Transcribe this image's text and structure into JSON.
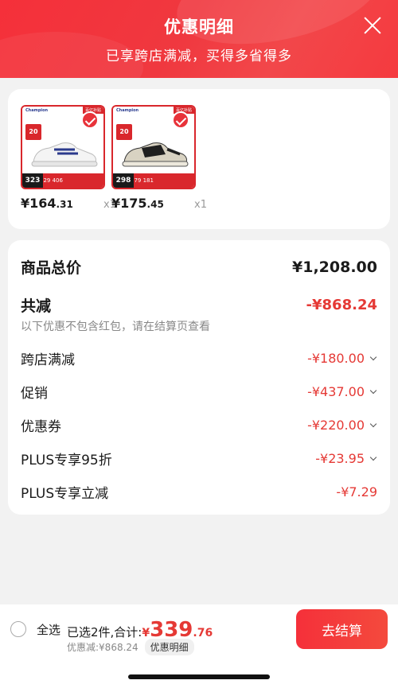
{
  "header": {
    "title": "优惠明细",
    "subtitle": "已享跨店满减，买得多省得多"
  },
  "products": [
    {
      "brand": "Champion",
      "tag": "百亿补贴",
      "badge": "20",
      "thumb_price": "323",
      "thumb_strip": "729  406",
      "price_int": "¥164",
      "price_dec": ".31",
      "qty": "x1",
      "colors": [
        "#ffffff",
        "#2b3a8c"
      ]
    },
    {
      "brand": "Champion",
      "tag": "百亿补贴",
      "badge": "20",
      "thumb_price": "298",
      "thumb_strip": "479  181",
      "price_int": "¥175",
      "price_dec": ".45",
      "qty": "x1",
      "colors": [
        "#1f1f1f",
        "#d8d2c2"
      ]
    }
  ],
  "summary": {
    "total_label": "商品总价",
    "total_value": "¥1,208.00",
    "discount_label": "共减",
    "discount_value": "-¥868.24",
    "note": "以下优惠不包含红包，请在结算页查看",
    "items": [
      {
        "label": "跨店满减",
        "value": "-¥180.00",
        "expandable": true
      },
      {
        "label": "促销",
        "value": "-¥437.00",
        "expandable": true
      },
      {
        "label": "优惠券",
        "value": "-¥220.00",
        "expandable": true
      },
      {
        "label": "PLUS专享95折",
        "value": "-¥23.95",
        "expandable": true
      },
      {
        "label": "PLUS专享立减",
        "value": "-¥7.29",
        "expandable": false
      }
    ]
  },
  "bottom": {
    "select_all": "全选",
    "selected_text": "已选2件,合计:",
    "yen": "¥",
    "total_int": "339",
    "total_dec": ".76",
    "discount_text": "优惠减:¥868.24",
    "detail_label": "优惠明细",
    "checkout_label": "去结算"
  },
  "colors": {
    "accent": "#e53935",
    "header": "#f5303a"
  }
}
